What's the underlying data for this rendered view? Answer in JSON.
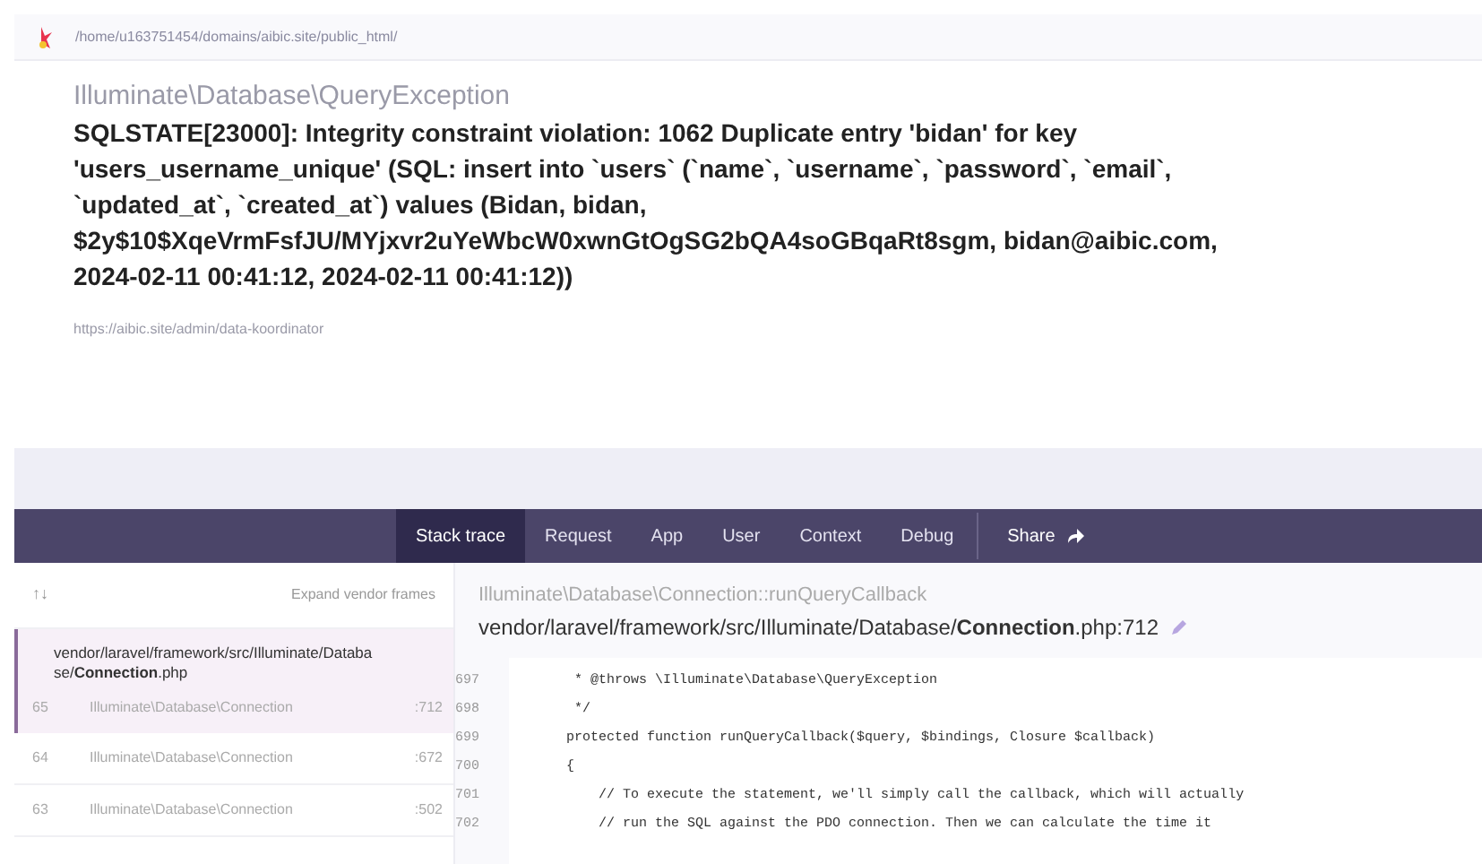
{
  "header": {
    "path": "/home/u163751454/domains/aibic.site/public_html/"
  },
  "exception": {
    "class": "Illuminate\\Database\\QueryException",
    "message": "SQLSTATE[23000]: Integrity constraint violation: 1062 Duplicate entry 'bidan' for key 'users_username_unique' (SQL: insert into `users` (`name`, `username`, `password`, `email`, `updated_at`, `created_at`) values (Bidan, bidan, $2y$10$XqeVrmFsfJU/MYjxvr2uYeWbcW0xwnGtOgSG2bQA4soGBqaRt8sgm, bidan@aibic.com, 2024-02-11 00:41:12, 2024-02-11 00:41:12))",
    "url": "https://aibic.site/admin/data-koordinator"
  },
  "tabs": [
    {
      "label": "Stack trace",
      "selected": true
    },
    {
      "label": "Request",
      "selected": false
    },
    {
      "label": "App",
      "selected": false
    },
    {
      "label": "User",
      "selected": false
    },
    {
      "label": "Context",
      "selected": false
    },
    {
      "label": "Debug",
      "selected": false
    }
  ],
  "share": {
    "label": "Share"
  },
  "frames_panel": {
    "sort_arrows": "↑↓",
    "expand": "Expand vendor frames",
    "frames": [
      {
        "file": "vendor/laravel/framework/src/Illuminate/Database/**Connection**.php",
        "number": "65",
        "class": "Illuminate\\Database\\Connection",
        "line": ":712",
        "selected": true
      },
      {
        "number": "64",
        "class": "Illuminate\\Database\\Connection",
        "line": ":672",
        "selected": false
      },
      {
        "number": "63",
        "class": "Illuminate\\Database\\Connection",
        "line": ":502",
        "selected": false
      }
    ]
  },
  "code_panel": {
    "method": "Illuminate\\Database\\Connection::runQueryCallback",
    "file": "vendor/laravel/framework/src/Illuminate/Database/**Connection**.php:712",
    "lines": [
      {
        "number": "697",
        "code": "     * @throws \\Illuminate\\Database\\QueryException"
      },
      {
        "number": "698",
        "code": "     */"
      },
      {
        "number": "699",
        "code": "    protected function runQueryCallback($query, $bindings, Closure $callback)"
      },
      {
        "number": "700",
        "code": "    {"
      },
      {
        "number": "701",
        "code": "        // To execute the statement, we'll simply call the callback, which will actually"
      },
      {
        "number": "702",
        "code": "        // run the SQL against the PDO connection. Then we can calculate the time it"
      }
    ]
  }
}
